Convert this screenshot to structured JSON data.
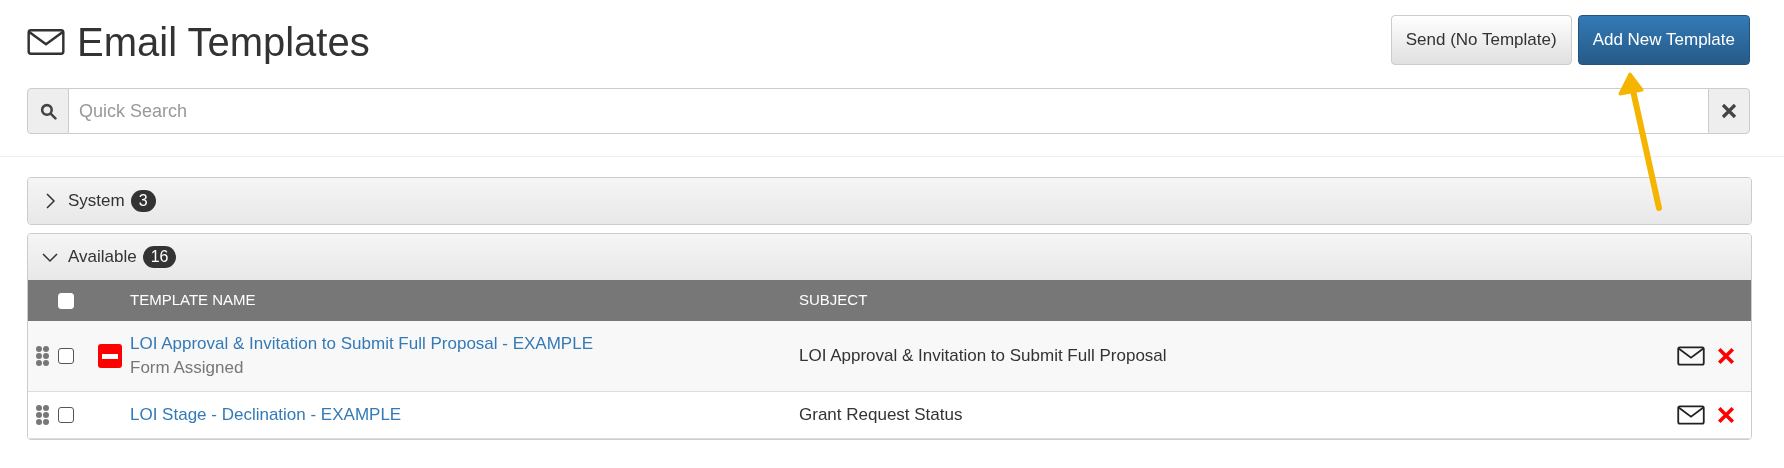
{
  "page": {
    "title": "Email Templates"
  },
  "buttons": [
    {
      "label": "Send (No Template)",
      "kind": "default"
    },
    {
      "label": "Add New Template",
      "kind": "primary"
    }
  ],
  "search": {
    "placeholder": "Quick Search"
  },
  "groups": [
    {
      "label": "System",
      "count": "3",
      "expanded": false
    },
    {
      "label": "Available",
      "count": "16",
      "expanded": true
    }
  ],
  "table": {
    "select_all_checked": false,
    "columns": [
      "TEMPLATE NAME",
      "SUBJECT"
    ],
    "rows": [
      {
        "name": "LOI Approval & Invitation to Submit Full Proposal - EXAMPLE",
        "note": "Form Assigned",
        "flagged": true,
        "checked": false,
        "subject": "LOI Approval & Invitation to Submit Full Proposal"
      },
      {
        "name": "LOI Stage - Declination - EXAMPLE",
        "flagged": false,
        "checked": false,
        "subject": "Grant Request Status"
      }
    ]
  }
}
